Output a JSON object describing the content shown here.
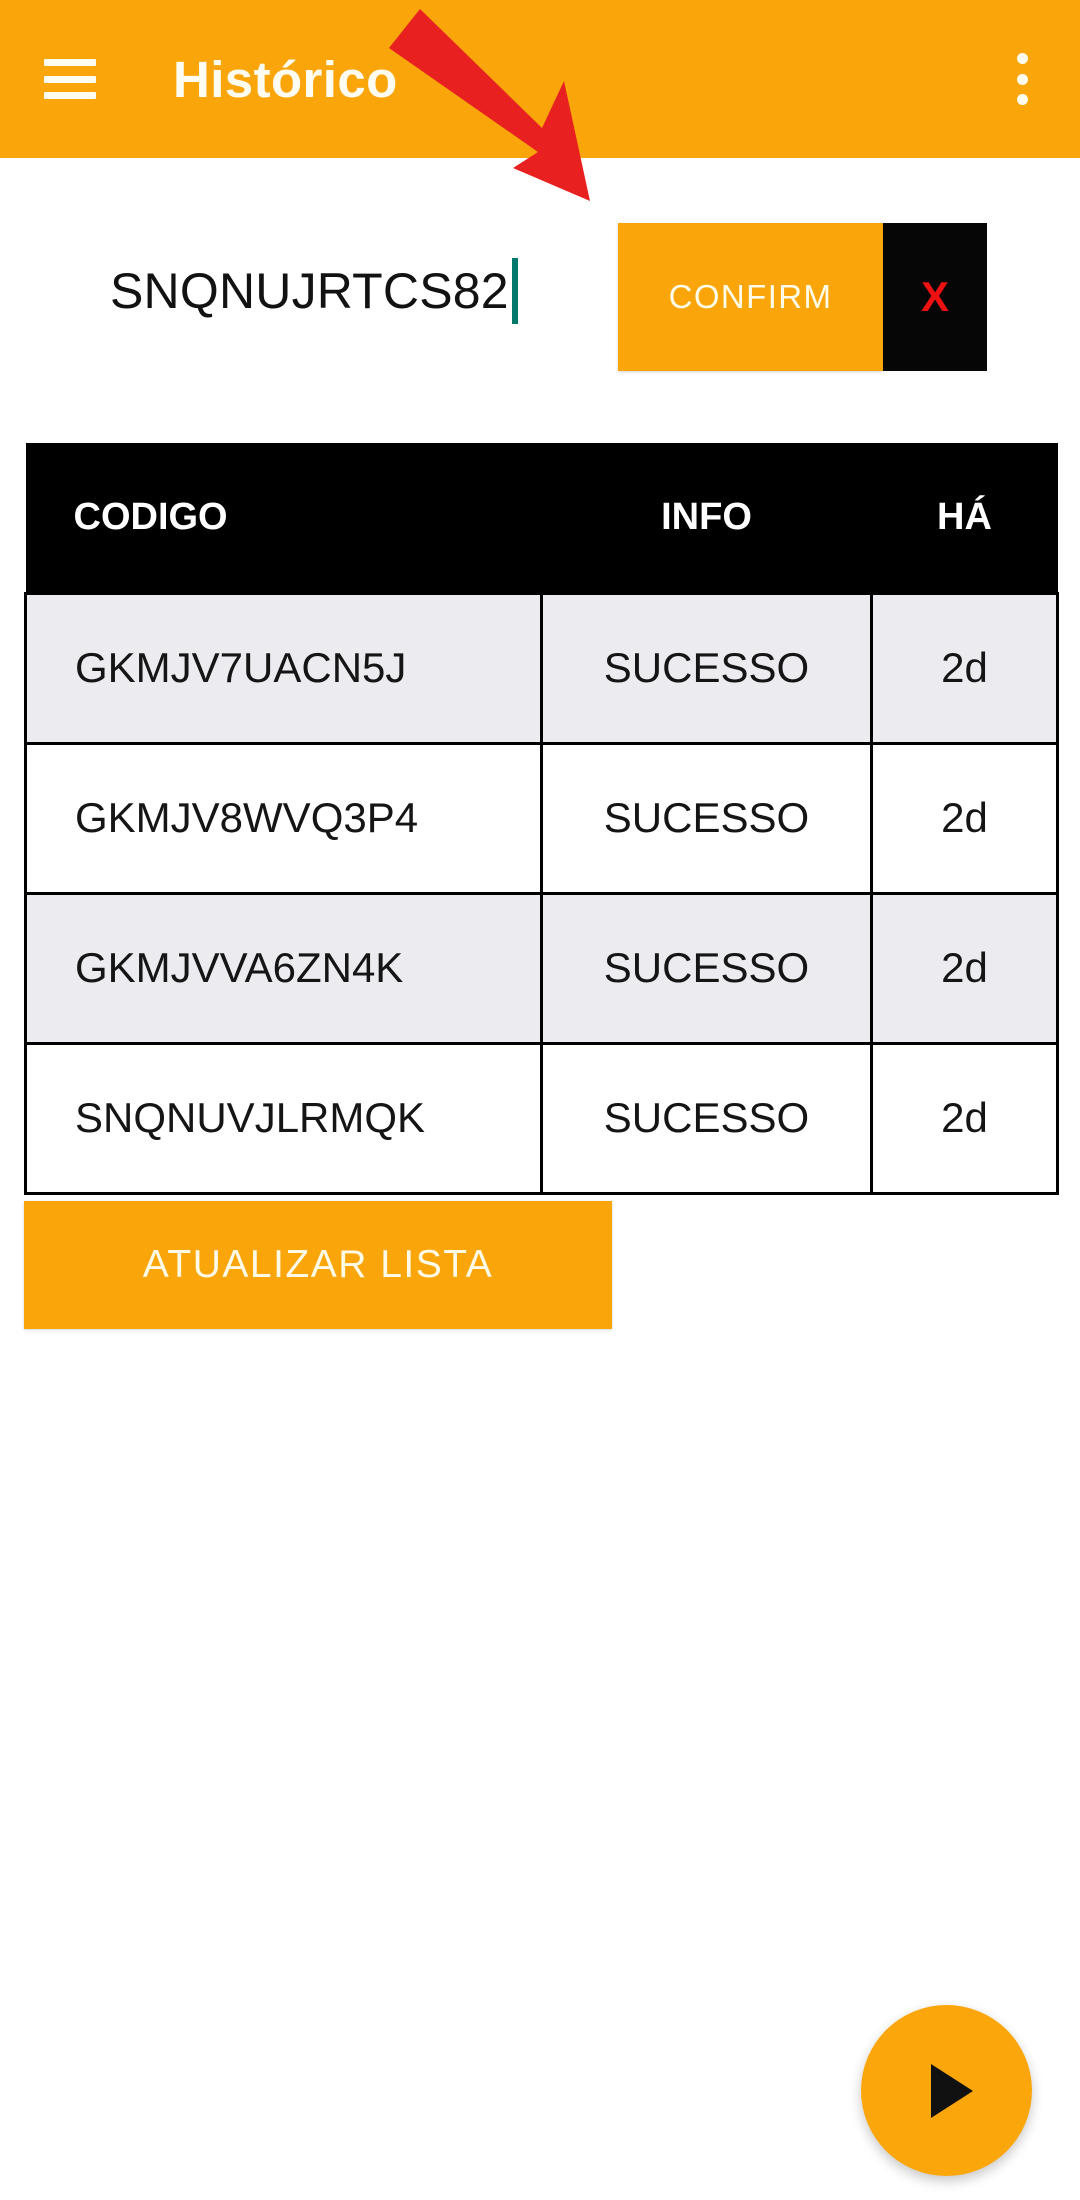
{
  "appbar": {
    "title": "Histórico",
    "menu_icon": "hamburger-menu-icon",
    "overflow_icon": "overflow-menu-icon",
    "background_color": "#FAA50A",
    "title_color": "#FFFDF2"
  },
  "annotation": {
    "arrow_icon": "arrow-down-right-icon",
    "color": "#E82020"
  },
  "input_row": {
    "code_value": "SNQNUJRTCS82",
    "code_placeholder": "",
    "caret_color": "#00796B",
    "confirm_label": "CONFIRM",
    "confirm_color": "#FAA50A",
    "clear_label": "X",
    "clear_background": "#060606",
    "clear_color": "#EE1111"
  },
  "table": {
    "headers": [
      "CODIGO",
      "INFO",
      "HÁ"
    ],
    "rows": [
      {
        "codigo": "GKMJV7UACN5J",
        "info": "SUCESSO",
        "ha": "2d"
      },
      {
        "codigo": "GKMJV8WVQ3P4",
        "info": "SUCESSO",
        "ha": "2d"
      },
      {
        "codigo": "GKMJVVA6ZN4K",
        "info": "SUCESSO",
        "ha": "2d"
      },
      {
        "codigo": "SNQNUVJLRMQK",
        "info": "SUCESSO",
        "ha": "2d"
      }
    ],
    "header_background": "#000000",
    "alt_row_background": "#ECECF0"
  },
  "refresh": {
    "label": "ATUALIZAR LISTA",
    "color": "#FAA50A"
  },
  "fab": {
    "icon": "play-icon",
    "color": "#FBA60A"
  }
}
